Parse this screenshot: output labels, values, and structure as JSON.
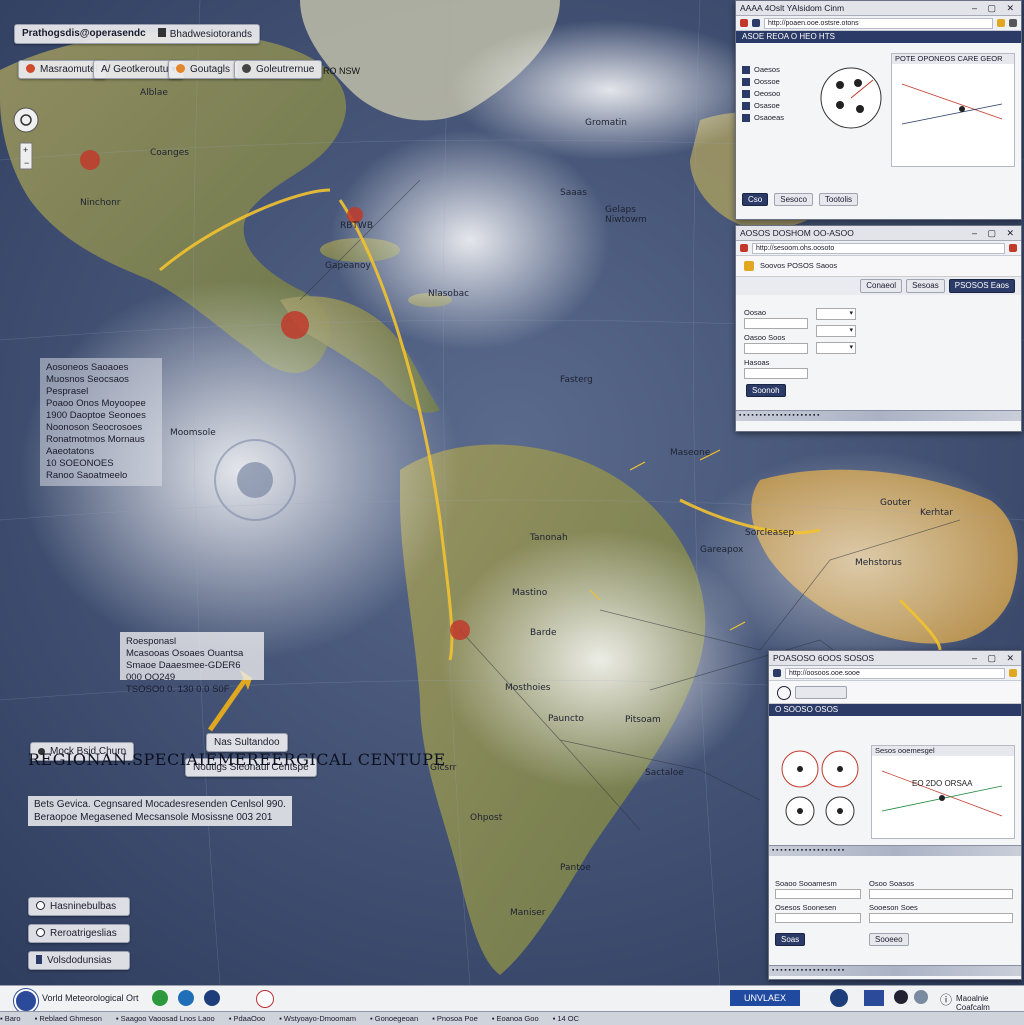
{
  "header": {
    "title_chip": "Prathogsdis@operasendc",
    "right_chip": "Bhadwesiotorands"
  },
  "toolbar": {
    "chip1": "Masraomutel",
    "chip2": "Geotkeroutu",
    "chip2_prefix": "A/",
    "chip3": "Goutagls",
    "chip4": "Goleutrernue",
    "chip4_suffix": "RO NSW"
  },
  "map_labels": [
    "Alblae",
    "Gromatin",
    "Coanges",
    "Ninchonr",
    "Gapeanoy",
    "Moomsole",
    "Saaas",
    "Niwtowm",
    "RBTWB",
    "Nlasobac",
    "Fasterg",
    "Tanonah",
    "Mastino",
    "Barde",
    "Mosthoies",
    "Pauncto",
    "Pitsoam",
    "Sactaloe",
    "Gicsrr",
    "Pantoe",
    "Gareapox",
    "Mehstorus",
    "Gouter",
    "Kerhtar",
    "Sorcleasep",
    "Gelaps",
    "Maniser",
    "Maseone",
    "Ohpost"
  ],
  "side_text_block": [
    "Aosoneos Saoaoes",
    "Muosnos Seocsaos Pesprasel",
    "Poaoo Onos Moyoopee",
    "1900 Daoptoe Seonoes",
    "Noonoson Seocrosoes",
    "Ronatmotmos Mornaus",
    "Aaeotatons",
    "10 SOEONOES",
    "Ranoo Saoatmeelo"
  ],
  "info_box": {
    "line1": "Roesponasl",
    "line2": "Mcasooas Osoaes Ouantsa",
    "line3": "Smaoe Daaesmee-GDER6 000 OO249",
    "line4": "TSOSO0 0. 130 0.0 S0F"
  },
  "buttons": {
    "mock": "Mock Bsid Churn",
    "sub": "Nas Sultandoo",
    "notice": "Noutigs Sleonaul Centspe"
  },
  "main_title": "REGIONAN.SPECIAIEMEREERGICAL CENTUPE",
  "subtitle_lines": [
    "Bets Gevica. Cegnsared Mocadesresenden Cenlsol 990.",
    "Beraopoe Megasened Mecsansole Mosissne 003 201"
  ],
  "legend": [
    {
      "label": "Hasninebulbas",
      "icon": "info-icon"
    },
    {
      "label": "Reroatrigeslias",
      "icon": "info-icon"
    },
    {
      "label": "Volsdodunsias",
      "icon": "bookmark-icon"
    }
  ],
  "window_top": {
    "title": "AAAA 4Oslt YAlsidom Cinm",
    "address": "http://poaen.ooe.ostsre.otons",
    "nav": "ASOE REOA O HEO HTS",
    "panel_title": "POTE OPONEOS CARE GEOR",
    "list": [
      "Oaesos",
      "Oossoe",
      "Oeosoo",
      "Osasoe",
      "Osaoeas"
    ],
    "buttons": [
      "Cso",
      "Sesoco",
      "Tootolis"
    ]
  },
  "window_mid": {
    "title": "AOSOS DOSHOM  OO-ASOO",
    "address": "http://sesoom.ohs.oosoto",
    "nav": "Soovos  POSOS Saoos",
    "tabs": [
      "Conaeol",
      "Sesoas",
      "PSOSOS Eaos"
    ],
    "field_labels": [
      "Oosao",
      "Oasoo Soos",
      "Hasoas"
    ],
    "button": "Soonoh"
  },
  "window_bot": {
    "title": "POASOSO 6OOS SOSOS",
    "address": "http://oosoos.ooe.sooe",
    "nav": "O SOOSO OSOS",
    "panel_title": "Sesos ooemesgel",
    "chart_label": "EO 2DO ORSAA",
    "form_labels": [
      "Soaoo Sooamesm",
      "Osesos Soonesen",
      "Osoo Soasos",
      "Sooeson Soes"
    ],
    "buttons": [
      "Soas",
      "Sooeeo"
    ]
  },
  "footer": {
    "left_label": "Vorld Meteorological Ort",
    "right_badge": "UNVLAEX",
    "right_label": "Maoalnie Coafcalm",
    "taskbar": [
      "Baro",
      "Reblaed Ghmeson",
      "Saagoo Vaoosad Lnos Laoo",
      "PdaaOoo",
      "Wstyoayo-Dmoomam",
      "Gonoegeoan",
      "Pnosoa Poe",
      "Eoanoa Goo",
      "14 OC"
    ]
  },
  "colors": {
    "ocean": "#3a4a6c",
    "land": "#8a8a55",
    "track": "#f2c230",
    "nav_dark": "#2b3a66",
    "alert": "#c03a2a"
  }
}
